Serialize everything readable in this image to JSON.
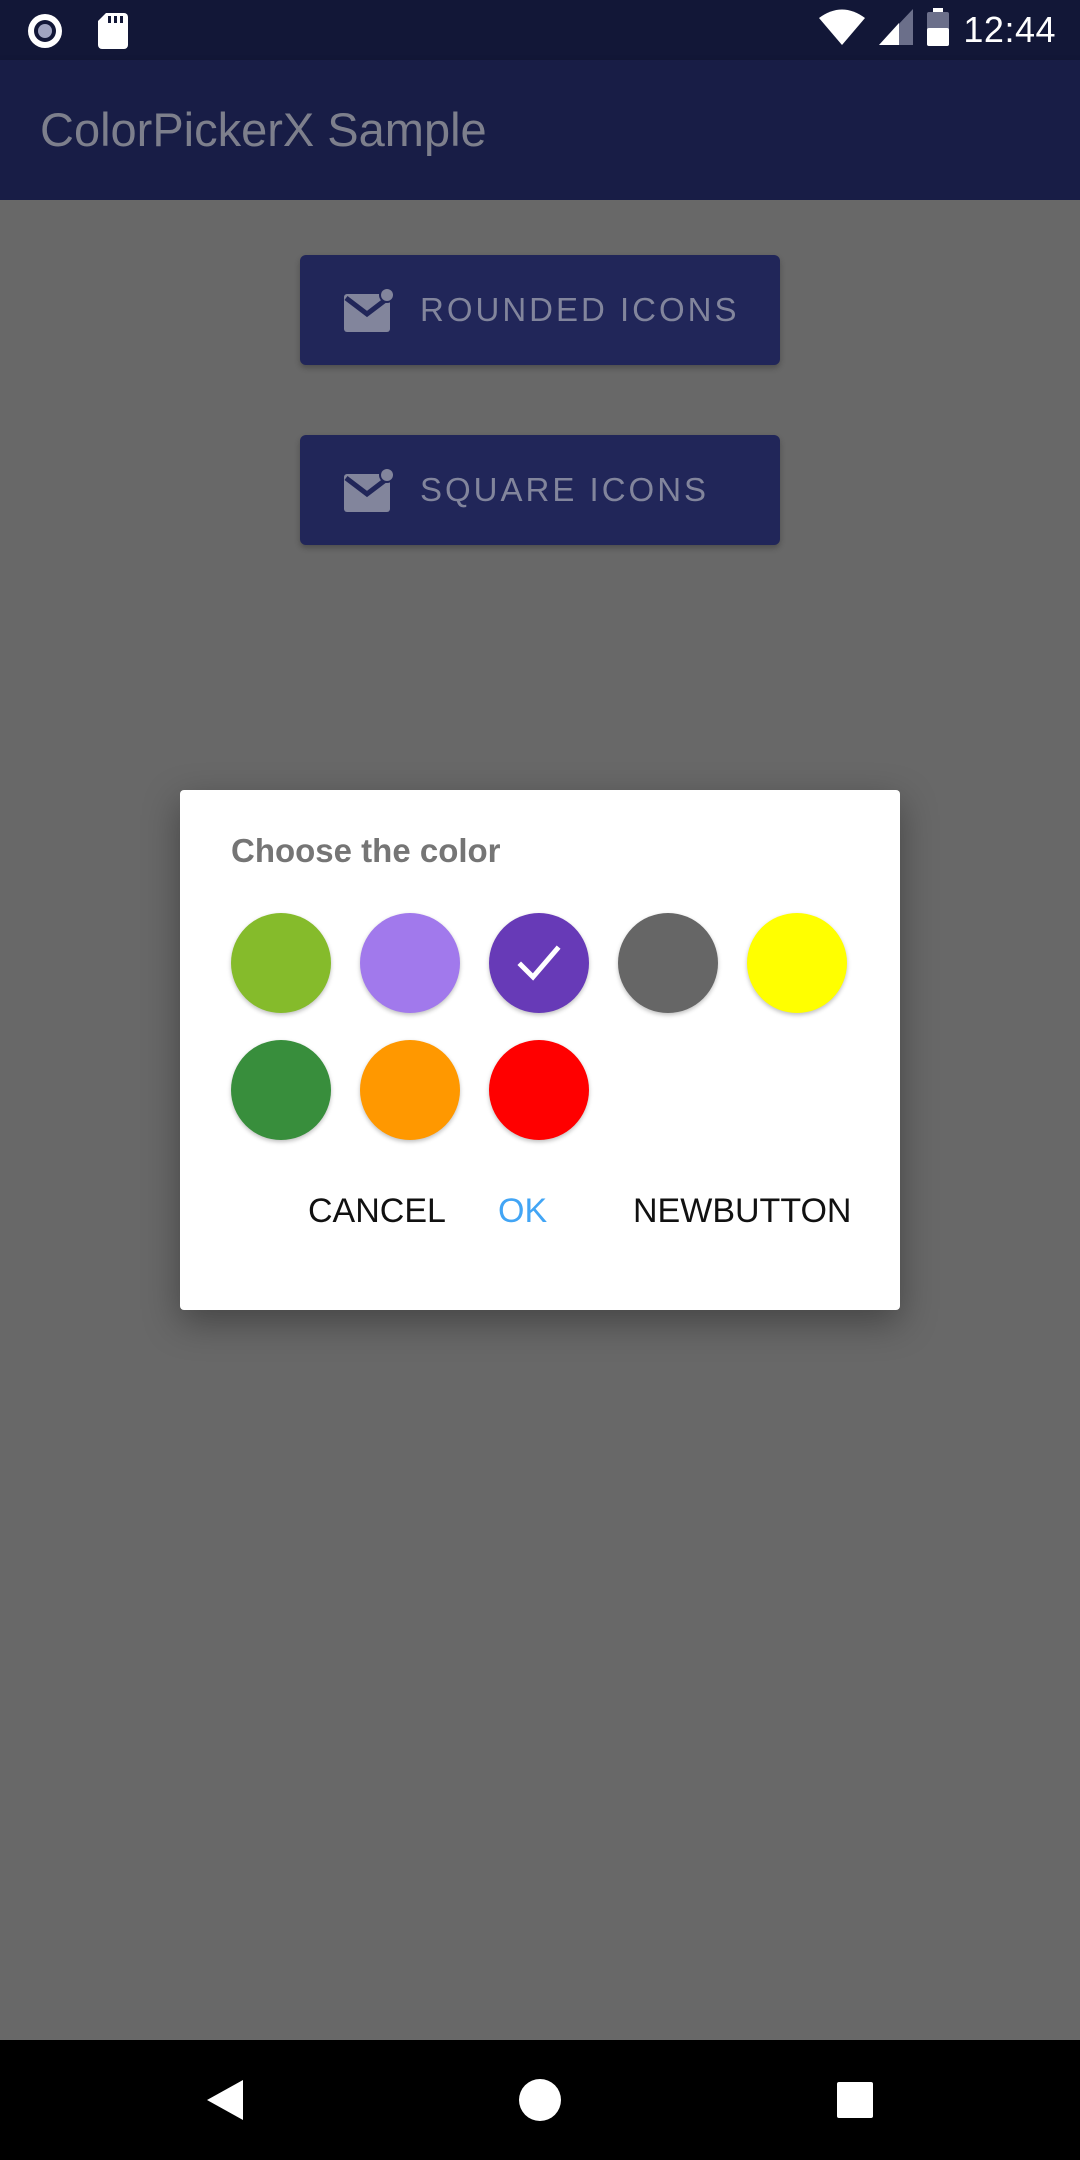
{
  "status_bar": {
    "time": "12:44",
    "left_icons": [
      "record-icon",
      "sd-card-icon"
    ],
    "right_icons": [
      "wifi-icon",
      "signal-icon",
      "battery-icon"
    ]
  },
  "app_bar": {
    "title": "ColorPickerX Sample"
  },
  "buttons": [
    {
      "label": "ROUNDED ICONS",
      "icon": "mail-badge-icon"
    },
    {
      "label": "SQUARE ICONS",
      "icon": "mail-badge-icon"
    }
  ],
  "dialog": {
    "title": "Choose the color",
    "swatches": [
      {
        "color": "#85bb2b",
        "selected": false
      },
      {
        "color": "#a179ec",
        "selected": false
      },
      {
        "color": "#673ab7",
        "selected": true
      },
      {
        "color": "#666666",
        "selected": false
      },
      {
        "color": "#ffff00",
        "selected": false
      },
      {
        "color": "#388e3c",
        "selected": false
      },
      {
        "color": "#ff9800",
        "selected": false
      },
      {
        "color": "#ff0000",
        "selected": false
      }
    ],
    "cancel_label": "CANCEL",
    "ok_label": "OK",
    "new_label": "NEWBUTTON"
  },
  "nav_bar": {
    "icons": [
      "back-icon",
      "home-icon",
      "recents-icon"
    ]
  }
}
